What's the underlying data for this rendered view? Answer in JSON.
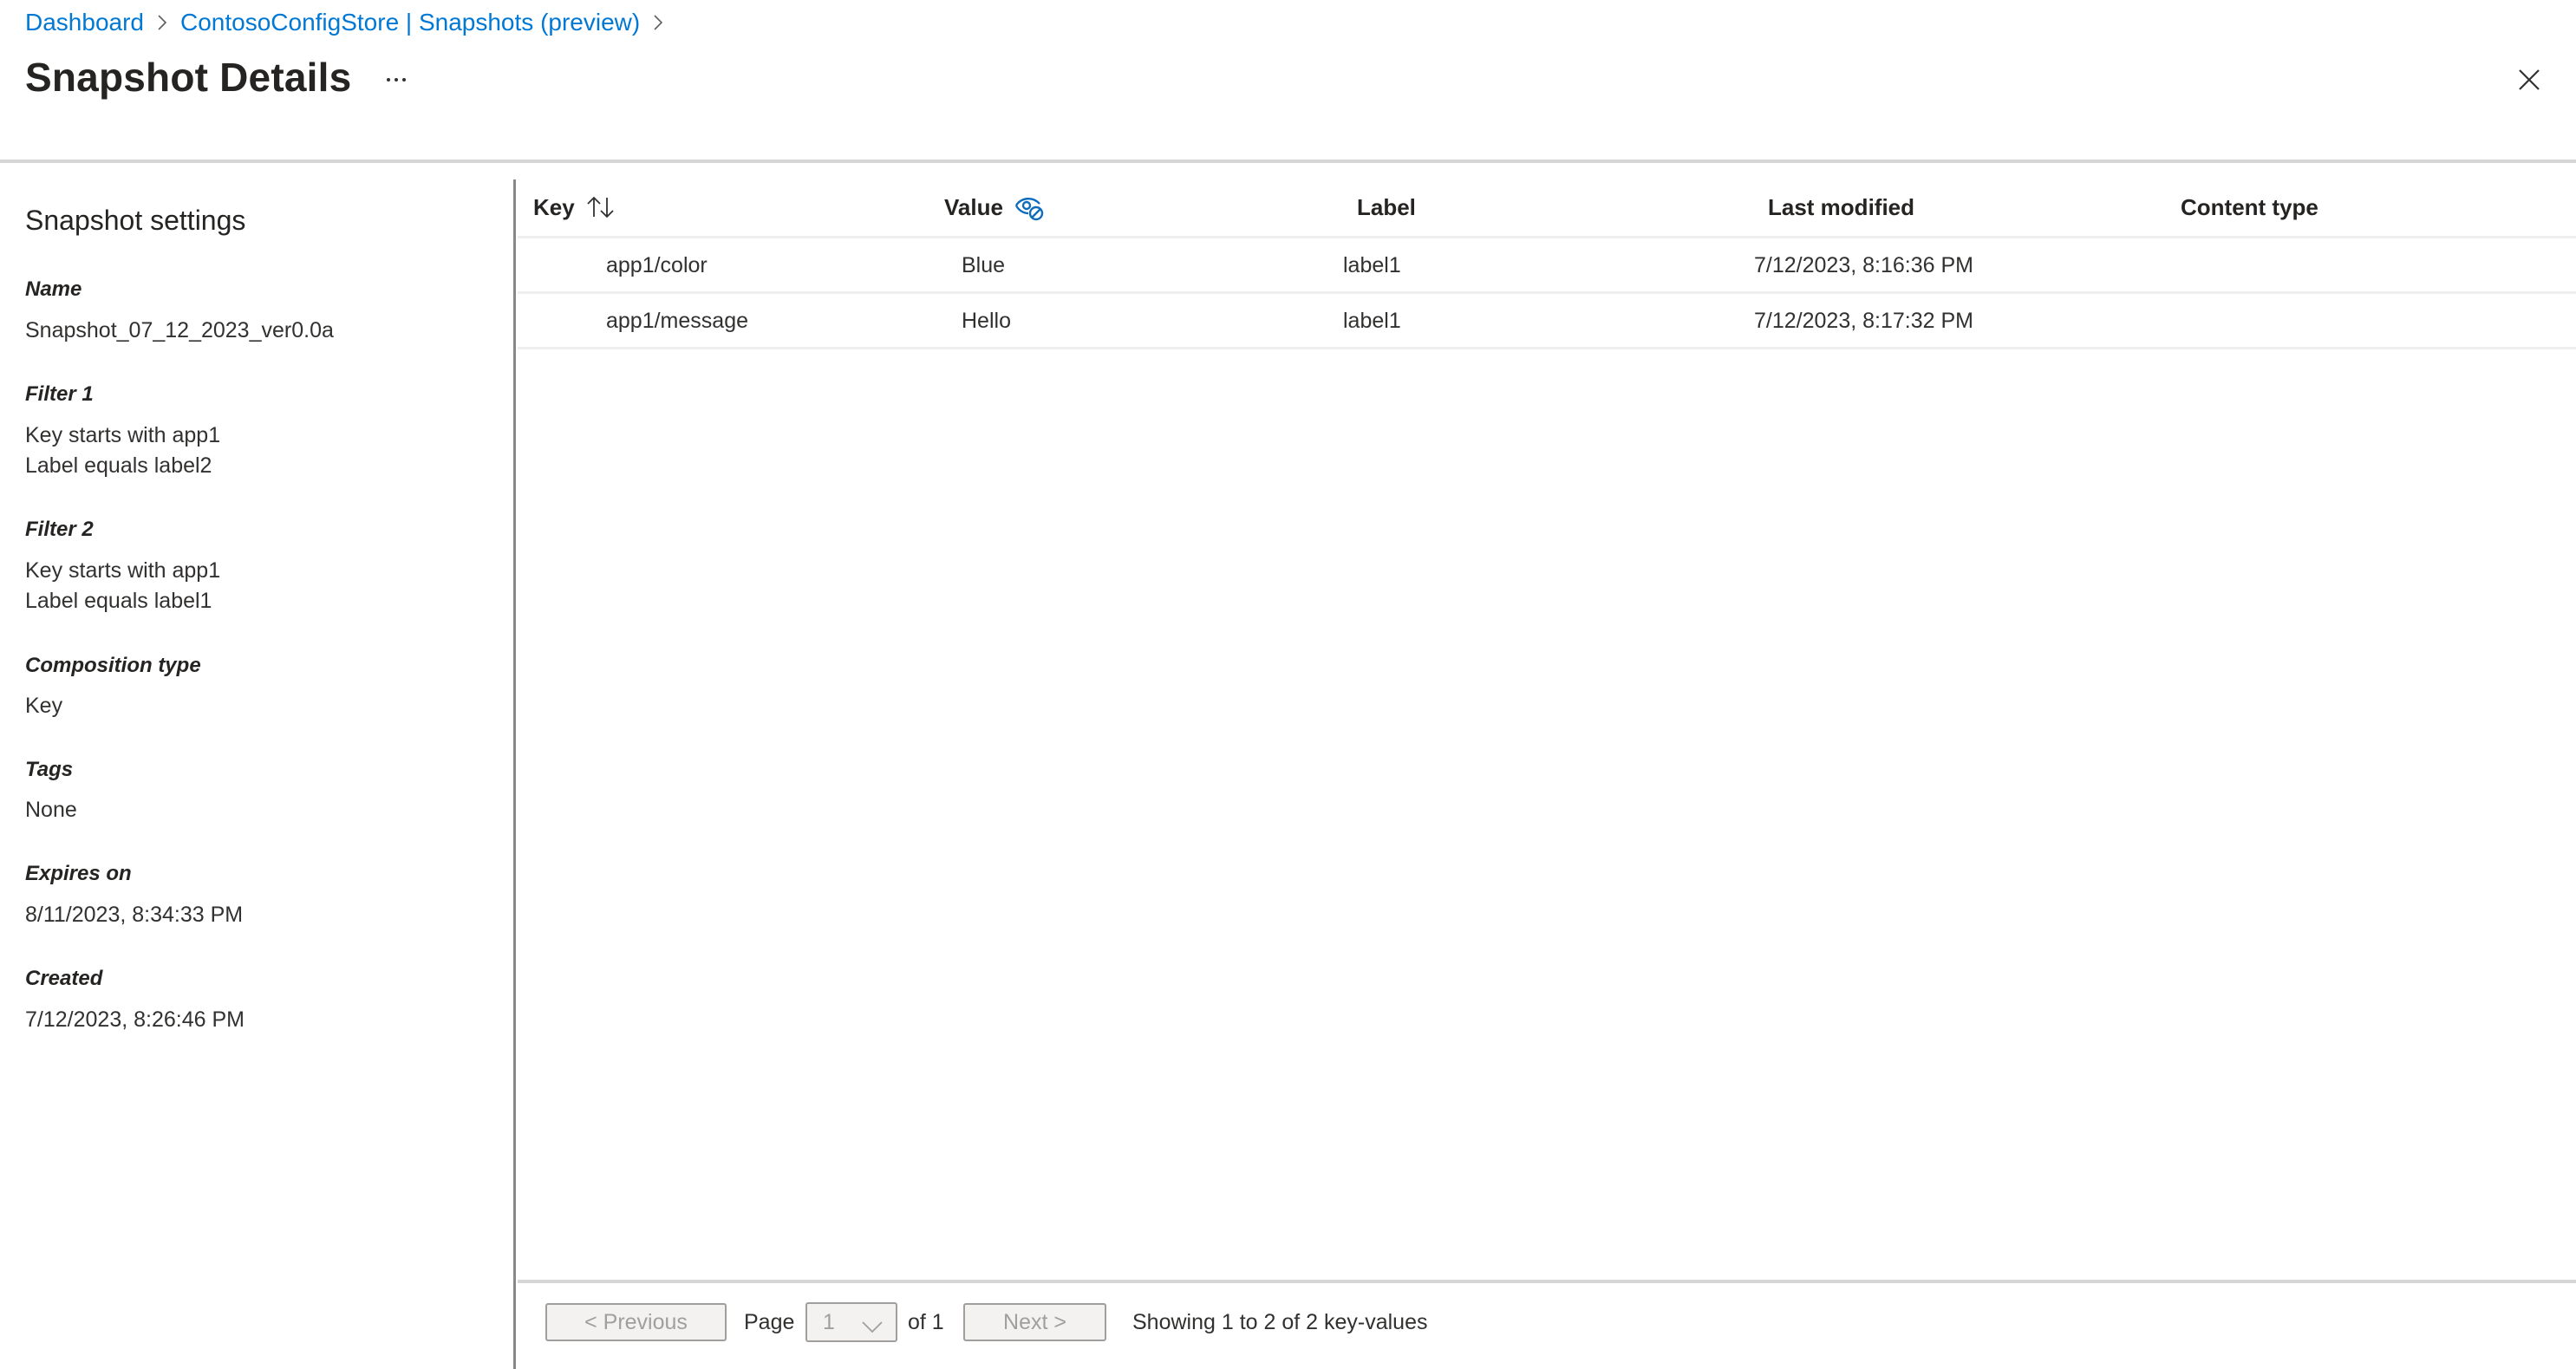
{
  "breadcrumb": {
    "items": [
      {
        "label": "Dashboard"
      },
      {
        "label": "ContosoConfigStore | Snapshots (preview)"
      }
    ]
  },
  "header": {
    "title": "Snapshot Details",
    "more_icon": "ellipsis-icon",
    "close_icon": "close-icon"
  },
  "sidebar": {
    "heading": "Snapshot settings",
    "fields": [
      {
        "label": "Name",
        "values": [
          "Snapshot_07_12_2023_ver0.0a"
        ]
      },
      {
        "label": "Filter 1",
        "values": [
          "Key starts with app1",
          "Label equals label2"
        ]
      },
      {
        "label": "Filter 2",
        "values": [
          "Key starts with app1",
          "Label equals label1"
        ]
      },
      {
        "label": "Composition type",
        "values": [
          "Key"
        ]
      },
      {
        "label": "Tags",
        "values": [
          "None"
        ]
      },
      {
        "label": "Expires on",
        "values": [
          "8/11/2023, 8:34:33 PM"
        ]
      },
      {
        "label": "Created",
        "values": [
          "7/12/2023, 8:26:46 PM"
        ]
      }
    ]
  },
  "table": {
    "columns": [
      {
        "label": "Key",
        "icon": "sort-icon"
      },
      {
        "label": "Value",
        "icon": "eye-hidden-icon"
      },
      {
        "label": "Label"
      },
      {
        "label": "Last modified"
      },
      {
        "label": "Content type"
      }
    ],
    "rows": [
      {
        "key": "app1/color",
        "value": "Blue",
        "label": "label1",
        "last_modified": "7/12/2023, 8:16:36 PM",
        "content_type": ""
      },
      {
        "key": "app1/message",
        "value": "Hello",
        "label": "label1",
        "last_modified": "7/12/2023, 8:17:32 PM",
        "content_type": ""
      }
    ]
  },
  "pager": {
    "previous_label": "< Previous",
    "page_label": "Page",
    "page_value": "1",
    "of_label": "of 1",
    "next_label": "Next >",
    "summary": "Showing 1 to 2 of 2 key-values"
  },
  "colors": {
    "link": "#0078d4",
    "text": "#323130",
    "divider": "#d6d6d6",
    "disabled": "#a19f9d"
  }
}
